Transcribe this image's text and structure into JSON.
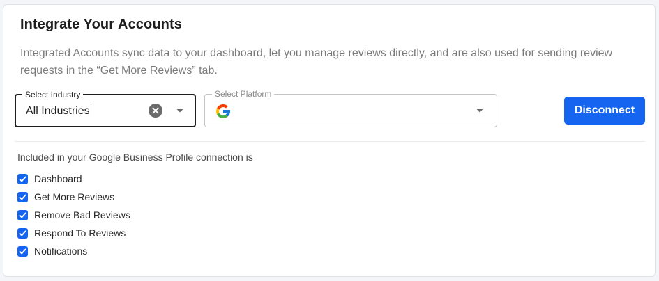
{
  "card": {
    "title": "Integrate Your Accounts",
    "description": "Integrated Accounts sync data to your dashboard, let you manage reviews directly, and are also used for sending review requests in the “Get More Reviews” tab."
  },
  "industry_select": {
    "label": "Select Industry",
    "value": "All Industries",
    "icons": [
      "clear-icon",
      "dropdown-arrow-icon"
    ]
  },
  "platform_select": {
    "label": "Select Platform",
    "selected_icon": "google-icon",
    "icons": [
      "dropdown-arrow-icon"
    ]
  },
  "actions": {
    "disconnect_label": "Disconnect",
    "accent_color": "#1565f0"
  },
  "connection": {
    "included_label": "Included in your Google Business Profile connection is",
    "features": [
      {
        "label": "Dashboard",
        "checked": true
      },
      {
        "label": "Get More Reviews",
        "checked": true
      },
      {
        "label": "Remove Bad Reviews",
        "checked": true
      },
      {
        "label": "Respond To Reviews",
        "checked": true
      },
      {
        "label": "Notifications",
        "checked": true
      }
    ]
  }
}
